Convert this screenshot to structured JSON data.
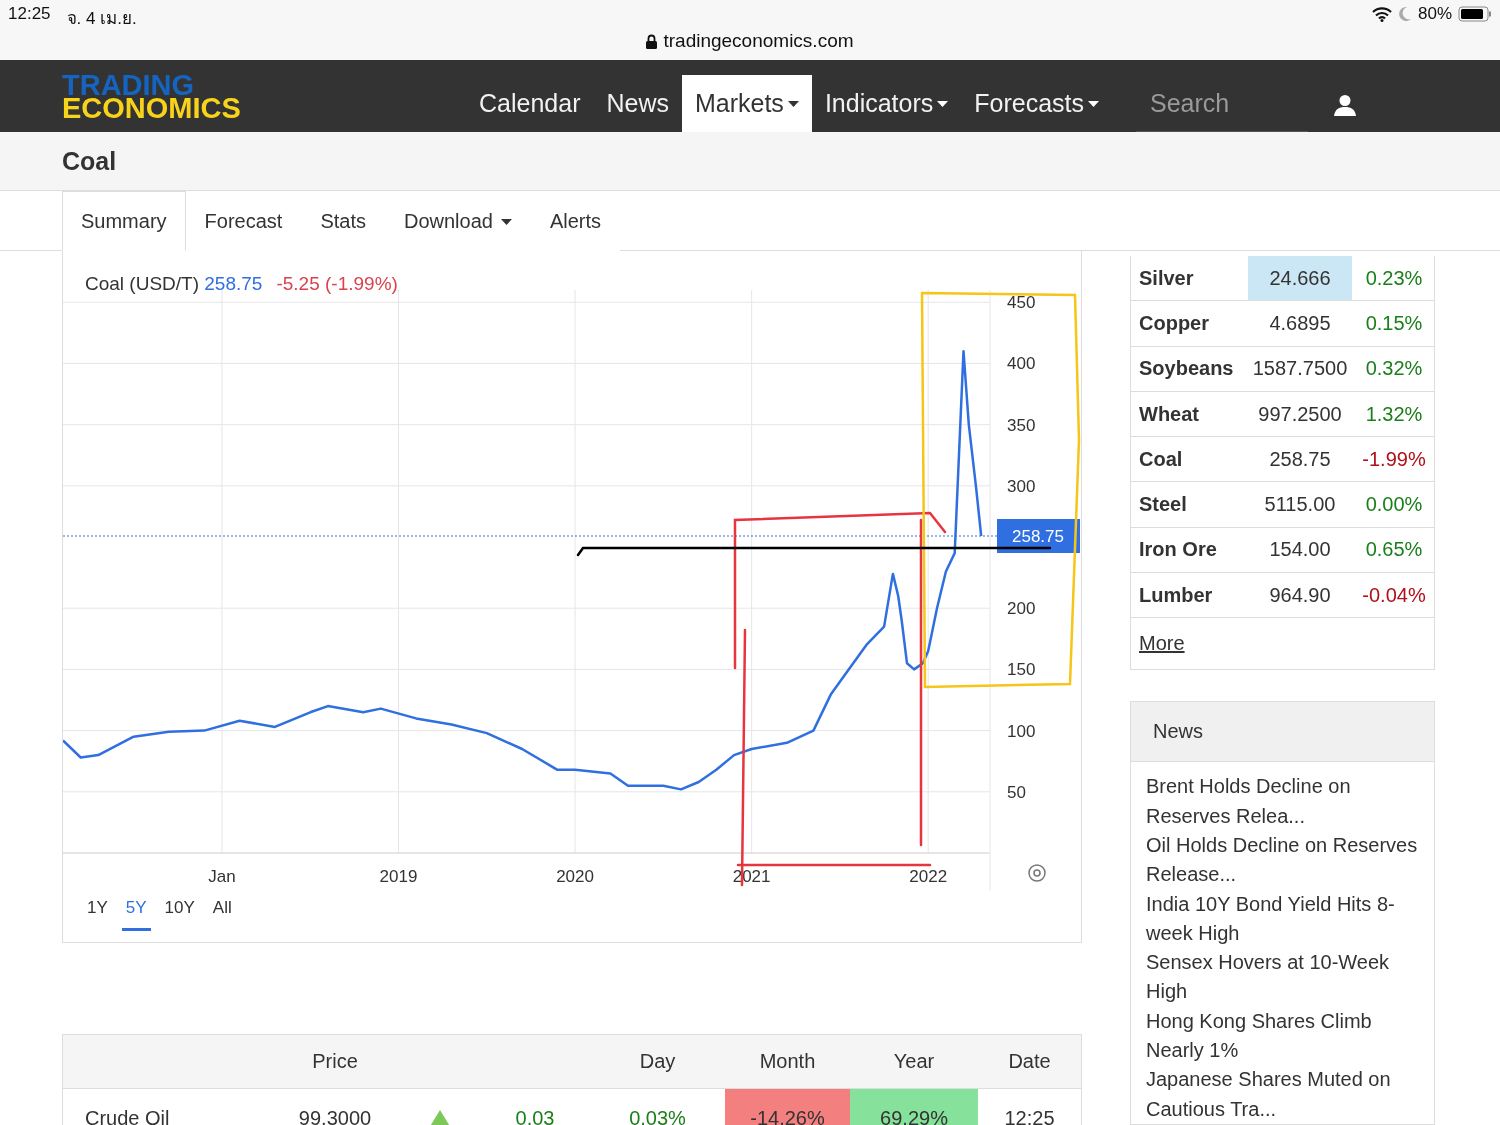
{
  "status_bar": {
    "time": "12:25",
    "date": "จ. 4 เม.ย.",
    "battery": "80%"
  },
  "address_bar": {
    "url": "tradingeconomics.com"
  },
  "navbar": {
    "logo_top": "TRADING",
    "logo_bottom": "ECONOMICS",
    "items": [
      {
        "label": "Calendar",
        "selected": false,
        "dropdown": false
      },
      {
        "label": "News",
        "selected": false,
        "dropdown": false
      },
      {
        "label": "Markets",
        "selected": true,
        "dropdown": true
      },
      {
        "label": "Indicators",
        "selected": false,
        "dropdown": true
      },
      {
        "label": "Forecasts",
        "selected": false,
        "dropdown": true
      }
    ],
    "search": {
      "placeholder": "Search"
    }
  },
  "page_title": "Coal",
  "tabs": [
    {
      "label": "Summary",
      "selected": true,
      "dropdown": false
    },
    {
      "label": "Forecast",
      "selected": false,
      "dropdown": false
    },
    {
      "label": "Stats",
      "selected": false,
      "dropdown": false
    },
    {
      "label": "Download",
      "selected": false,
      "dropdown": true
    },
    {
      "label": "Alerts",
      "selected": false,
      "dropdown": false
    }
  ],
  "chart": {
    "price": "258.75",
    "change": "-5.25 (-1.99%)",
    "price_tag": "258.75",
    "ranges": [
      {
        "label": "1Y",
        "selected": false
      },
      {
        "label": "5Y",
        "selected": true
      },
      {
        "label": "10Y",
        "selected": false
      },
      {
        "label": "All",
        "selected": false
      }
    ],
    "chart_data": {
      "type": "line",
      "grid": true,
      "xlim": [
        2017.1,
        2022.35
      ],
      "ylim": [
        0,
        460
      ],
      "x": [
        2017.1,
        2017.2,
        2017.3,
        2017.5,
        2017.7,
        2017.9,
        2018.1,
        2018.3,
        2018.5,
        2018.6,
        2018.8,
        2018.9,
        2019.1,
        2019.3,
        2019.5,
        2019.7,
        2019.9,
        2020.0,
        2020.2,
        2020.3,
        2020.5,
        2020.6,
        2020.7,
        2020.8,
        2020.9,
        2021.0,
        2021.2,
        2021.35,
        2021.45,
        2021.55,
        2021.65,
        2021.75,
        2021.8,
        2021.83,
        2021.85,
        2021.88,
        2021.92,
        2021.97,
        2022.0,
        2022.05,
        2022.1,
        2022.15,
        2022.2,
        2022.23,
        2022.27,
        2022.3
      ],
      "series": [
        {
          "name": "Coal (USD/T)",
          "color": "#2f6fe0",
          "values": [
            92,
            78,
            80,
            95,
            99,
            100,
            108,
            103,
            115,
            120,
            115,
            118,
            110,
            105,
            98,
            85,
            68,
            68,
            65,
            55,
            55,
            52,
            58,
            68,
            80,
            85,
            90,
            100,
            130,
            150,
            170,
            185,
            228,
            210,
            190,
            155,
            150,
            155,
            165,
            200,
            230,
            245,
            410,
            350,
            300,
            259
          ]
        }
      ],
      "yticks": [
        50,
        100,
        150,
        200,
        300,
        350,
        400,
        450
      ],
      "xticks": [
        {
          "value": 2018,
          "label": "Jan"
        },
        {
          "value": 2019,
          "label": "2019"
        },
        {
          "value": 2020,
          "label": "2020"
        },
        {
          "value": 2021,
          "label": "2021"
        },
        {
          "value": 2022,
          "label": "2022"
        }
      ]
    }
  },
  "markets": {
    "rows": [
      {
        "name": "Silver",
        "price": "24.666",
        "change": "0.23%",
        "up": true,
        "highlighted": true
      },
      {
        "name": "Copper",
        "price": "4.6895",
        "change": "0.15%",
        "up": true,
        "highlighted": false
      },
      {
        "name": "Soybeans",
        "price": "1587.7500",
        "change": "0.32%",
        "up": true,
        "highlighted": false
      },
      {
        "name": "Wheat",
        "price": "997.2500",
        "change": "1.32%",
        "up": true,
        "highlighted": false
      },
      {
        "name": "Coal",
        "price": "258.75",
        "change": "-1.99%",
        "up": false,
        "highlighted": false
      },
      {
        "name": "Steel",
        "price": "5115.00",
        "change": "0.00%",
        "up": true,
        "highlighted": false
      },
      {
        "name": "Iron Ore",
        "price": "154.00",
        "change": "0.65%",
        "up": true,
        "highlighted": false
      },
      {
        "name": "Lumber",
        "price": "964.90",
        "change": "-0.04%",
        "up": false,
        "highlighted": false
      }
    ],
    "more": "More"
  },
  "news": {
    "title": "News",
    "items": [
      "Brent Holds Decline on Reserves Relea...",
      "Oil Holds Decline on Reserves Release...",
      "India 10Y Bond Yield Hits 8-week High",
      "Sensex Hovers at 10-Week High",
      "Hong Kong Shares Climb Nearly 1%",
      "Japanese Shares Muted on Cautious Tra..."
    ]
  },
  "quotes_table": {
    "headers": {
      "price": "Price",
      "day": "Day",
      "month": "Month",
      "year": "Year",
      "date": "Date"
    },
    "rows": [
      {
        "name": "Crude Oil",
        "price": "99.3000",
        "up": true,
        "change": "0.03",
        "day": "0.03%",
        "month": "-14.26%",
        "month_up": false,
        "year": "69.29%",
        "year_up": true,
        "date": "12:25"
      }
    ]
  }
}
